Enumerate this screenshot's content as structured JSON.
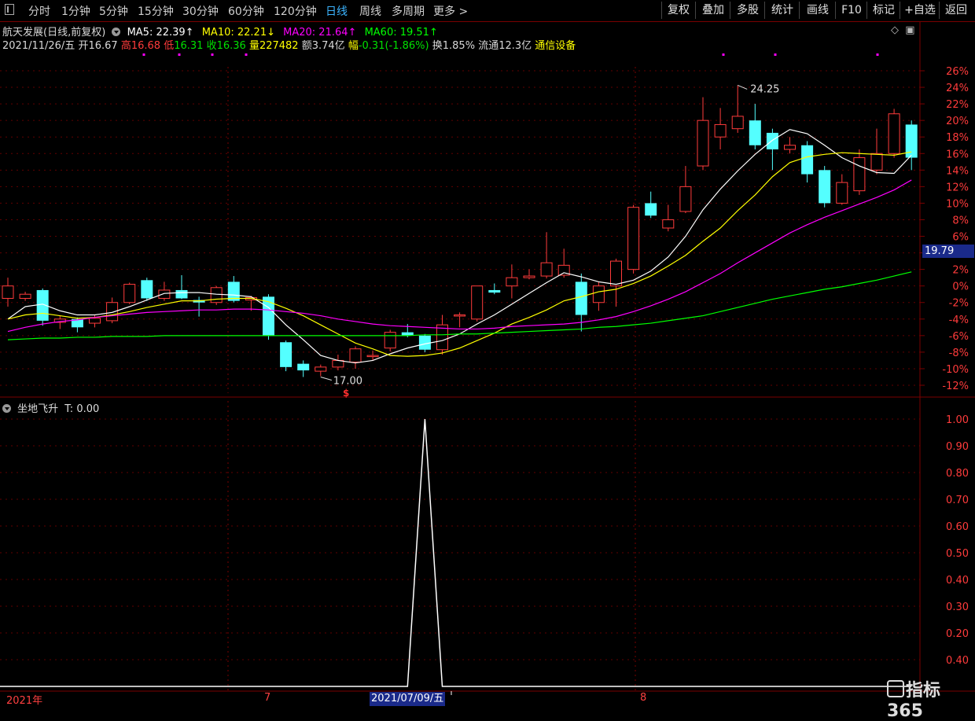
{
  "toolbar": {
    "left": [
      "分时",
      "1分钟",
      "5分钟",
      "15分钟",
      "30分钟",
      "60分钟",
      "120分钟",
      "日线",
      "周线",
      "多周期",
      "更多 >"
    ],
    "active": "日线",
    "right": [
      "复权",
      "叠加",
      "多股",
      "统计",
      "画线",
      "F10",
      "标记",
      "+自选",
      "返回"
    ]
  },
  "stock": {
    "name": "航天发展(日线,前复权)",
    "ma5": "MA5: 22.39↑",
    "ma10": "MA10: 22.21↓",
    "ma20": "MA20: 21.64↑",
    "ma60": "MA60: 19.51↑",
    "date": "2021/11/26/五",
    "open": "开16.67",
    "high_label": "高",
    "high": "16.68",
    "low_label": "低",
    "low": "16.31",
    "close_label": "收",
    "close": "16.36",
    "vol": "量227482",
    "amount": "额3.74亿",
    "change_label": "幅",
    "change": "-0.31(-1.86%)",
    "turnover": "换1.85%",
    "float": "流通12.3亿",
    "sector": "通信设备"
  },
  "price_tag": "19.79",
  "indicator": {
    "name": "坐地飞升",
    "t": "T: 0.00"
  },
  "dates": {
    "year": "2021年",
    "m7": "7",
    "highlight": "2021/07/09/五",
    "m8": "8"
  },
  "watermark": "指标365",
  "colors": {
    "up": "#ff3b3b",
    "down": "#54ffff",
    "ma5": "#ffffff",
    "ma10": "#ffff00",
    "ma20": "#ff00ff",
    "ma60": "#00ff00",
    "grid": "#7a0000"
  },
  "chart_data": [
    {
      "type": "candlestick",
      "y_axis_unit": "%",
      "ylim": [
        -13,
        27
      ],
      "yticks": [
        "26%",
        "24%",
        "22%",
        "20%",
        "18%",
        "16%",
        "14%",
        "12%",
        "10%",
        "8%",
        "6%",
        "4%",
        "2%",
        "0%",
        "-2%",
        "-4%",
        "-6%",
        "-8%",
        "-10%",
        "-12%"
      ],
      "annotations": [
        {
          "text": "24.25",
          "type": "high"
        },
        {
          "text": "17.00",
          "type": "low"
        }
      ],
      "candles": [
        {
          "o": -1.5,
          "c": 0.0,
          "h": 1.0,
          "l": -2.5
        },
        {
          "o": -1.5,
          "c": -1.0,
          "h": -0.7,
          "l": -1.8
        },
        {
          "o": -0.5,
          "c": -4.2,
          "h": -0.3,
          "l": -4.8
        },
        {
          "o": -4.4,
          "c": -4.0,
          "h": -3.6,
          "l": -5.2
        },
        {
          "o": -4.0,
          "c": -5.0,
          "h": -3.8,
          "l": -5.6
        },
        {
          "o": -4.5,
          "c": -3.9,
          "h": -3.5,
          "l": -5.0
        },
        {
          "o": -4.2,
          "c": -2.0,
          "h": -1.4,
          "l": -4.5
        },
        {
          "o": -2.0,
          "c": 0.2,
          "h": 0.4,
          "l": -2.2
        },
        {
          "o": 0.7,
          "c": -1.5,
          "h": 1.0,
          "l": -1.8
        },
        {
          "o": -1.5,
          "c": -0.5,
          "h": 0.5,
          "l": -1.8
        },
        {
          "o": -0.5,
          "c": -1.5,
          "h": 1.3,
          "l": -1.6
        },
        {
          "o": -1.7,
          "c": -2.0,
          "h": -1.3,
          "l": -3.7
        },
        {
          "o": -2.0,
          "c": -0.2,
          "h": 0.0,
          "l": -2.3
        },
        {
          "o": 0.5,
          "c": -1.8,
          "h": 1.2,
          "l": -2.0
        },
        {
          "o": -1.7,
          "c": -1.4,
          "h": -1.2,
          "l": -3.0
        },
        {
          "o": -1.3,
          "c": -6.0,
          "h": -1.0,
          "l": -6.5
        },
        {
          "o": -6.8,
          "c": -9.8,
          "h": -6.6,
          "l": -10.3
        },
        {
          "o": -9.4,
          "c": -10.2,
          "h": -9.0,
          "l": -11.0
        },
        {
          "o": -10.3,
          "c": -9.8,
          "h": -9.5,
          "l": -10.9
        },
        {
          "o": -9.8,
          "c": -9.0,
          "h": -8.3,
          "l": -10.2
        },
        {
          "o": -9.2,
          "c": -7.6,
          "h": -7.3,
          "l": -10.0
        },
        {
          "o": -8.5,
          "c": -8.4,
          "h": -7.8,
          "l": -9.0
        },
        {
          "o": -7.5,
          "c": -5.6,
          "h": -5.3,
          "l": -7.9
        },
        {
          "o": -5.6,
          "c": -6.0,
          "h": -4.6,
          "l": -6.2
        },
        {
          "o": -6.0,
          "c": -7.7,
          "h": -5.8,
          "l": -8.0
        },
        {
          "o": -7.7,
          "c": -4.7,
          "h": -3.5,
          "l": -8.3
        },
        {
          "o": -3.6,
          "c": -3.5,
          "h": -3.2,
          "l": -5.0
        },
        {
          "o": -4.0,
          "c": 0.0,
          "h": -0.5,
          "l": -4.3
        },
        {
          "o": -0.5,
          "c": -0.8,
          "h": 0.3,
          "l": -1.0
        },
        {
          "o": 0.0,
          "c": 1.0,
          "h": 2.6,
          "l": -1.5
        },
        {
          "o": 1.0,
          "c": 1.2,
          "h": 2.0,
          "l": 0.8
        },
        {
          "o": 1.2,
          "c": 2.8,
          "h": 6.5,
          "l": 0.9
        },
        {
          "o": 1.3,
          "c": 2.5,
          "h": 4.5,
          "l": 1.0
        },
        {
          "o": 0.5,
          "c": -3.5,
          "h": 1.5,
          "l": -5.5
        },
        {
          "o": -2.0,
          "c": 0.0,
          "h": 0.5,
          "l": -3.0
        },
        {
          "o": 0.0,
          "c": 3.0,
          "h": 3.3,
          "l": -2.5
        },
        {
          "o": 2.0,
          "c": 9.5,
          "h": 9.8,
          "l": 1.5
        },
        {
          "o": 10.0,
          "c": 8.5,
          "h": 11.4,
          "l": 8.2
        },
        {
          "o": 7.0,
          "c": 8.0,
          "h": 9.8,
          "l": 6.6
        },
        {
          "o": 9.0,
          "c": 12.0,
          "h": 14.5,
          "l": 8.8
        },
        {
          "o": 14.5,
          "c": 20.0,
          "h": 22.8,
          "l": 14.0
        },
        {
          "o": 18.0,
          "c": 19.5,
          "h": 21.5,
          "l": 16.5
        },
        {
          "o": 19.0,
          "c": 20.5,
          "h": 24.25,
          "l": 18.5
        },
        {
          "o": 20.0,
          "c": 17.0,
          "h": 22.0,
          "l": 16.5
        },
        {
          "o": 18.5,
          "c": 16.5,
          "h": 19.0,
          "l": 14.0
        },
        {
          "o": 16.5,
          "c": 17.0,
          "h": 18.0,
          "l": 16.0
        },
        {
          "o": 17.0,
          "c": 13.5,
          "h": 17.5,
          "l": 12.5
        },
        {
          "o": 14.0,
          "c": 10.0,
          "h": 14.5,
          "l": 9.5
        },
        {
          "o": 10.0,
          "c": 12.5,
          "h": 13.5,
          "l": 9.8
        },
        {
          "o": 11.5,
          "c": 15.5,
          "h": 16.5,
          "l": 11.0
        },
        {
          "o": 14.0,
          "c": 16.0,
          "h": 19.0,
          "l": 13.5
        },
        {
          "o": 16.0,
          "c": 20.8,
          "h": 21.4,
          "l": 15.5
        },
        {
          "o": 19.5,
          "c": 15.5,
          "h": 20.0,
          "l": 14.0
        }
      ],
      "series": [
        {
          "name": "MA5",
          "values": [
            -4.0,
            -2.5,
            -2.2,
            -3.0,
            -3.5,
            -3.5,
            -3.2,
            -2.5,
            -1.7,
            -0.9,
            -0.8,
            -0.8,
            -1.0,
            -1.1,
            -1.3,
            -2.6,
            -4.7,
            -6.5,
            -8.4,
            -9.0,
            -9.3,
            -9.0,
            -8.2,
            -7.5,
            -7.0,
            -6.6,
            -5.8,
            -4.6,
            -3.5,
            -2.2,
            -0.9,
            0.4,
            1.6,
            1.1,
            0.5,
            0.2,
            0.7,
            1.8,
            3.5,
            6.0,
            9.2,
            11.7,
            13.9,
            15.9,
            17.6,
            18.9,
            18.4,
            17.0,
            15.5,
            14.5,
            13.7,
            13.6,
            15.8
          ]
        },
        {
          "name": "MA10",
          "values": [
            -4.0,
            -3.5,
            -3.3,
            -3.6,
            -3.9,
            -3.8,
            -3.5,
            -3.1,
            -2.6,
            -2.2,
            -1.8,
            -1.8,
            -1.6,
            -1.5,
            -1.5,
            -1.9,
            -2.7,
            -3.6,
            -4.7,
            -5.8,
            -6.9,
            -7.6,
            -8.4,
            -8.5,
            -8.4,
            -8.1,
            -7.5,
            -6.6,
            -5.7,
            -4.6,
            -3.8,
            -2.9,
            -1.8,
            -1.3,
            -0.7,
            -0.4,
            0.3,
            1.2,
            2.4,
            3.7,
            5.4,
            7.0,
            9.1,
            11.0,
            13.2,
            14.9,
            15.6,
            15.9,
            16.1,
            16.0,
            15.9,
            15.8,
            16.2
          ]
        },
        {
          "name": "MA20",
          "values": [
            -5.5,
            -5.0,
            -4.6,
            -4.3,
            -4.1,
            -3.8,
            -3.6,
            -3.4,
            -3.2,
            -3.1,
            -3.0,
            -2.9,
            -2.9,
            -2.8,
            -2.8,
            -2.9,
            -3.1,
            -3.3,
            -3.6,
            -4.0,
            -4.3,
            -4.6,
            -4.8,
            -4.9,
            -5.0,
            -5.1,
            -5.2,
            -5.2,
            -5.1,
            -4.9,
            -4.8,
            -4.7,
            -4.6,
            -4.4,
            -4.1,
            -3.7,
            -3.1,
            -2.4,
            -1.6,
            -0.7,
            0.4,
            1.5,
            2.8,
            4.0,
            5.2,
            6.4,
            7.4,
            8.3,
            9.1,
            9.9,
            10.7,
            11.6,
            12.8
          ]
        },
        {
          "name": "MA60",
          "values": [
            -6.5,
            -6.4,
            -6.3,
            -6.3,
            -6.2,
            -6.2,
            -6.1,
            -6.1,
            -6.1,
            -6.0,
            -6.0,
            -6.0,
            -6.0,
            -6.0,
            -6.0,
            -6.0,
            -6.0,
            -6.0,
            -6.0,
            -6.0,
            -6.0,
            -6.0,
            -6.0,
            -6.0,
            -5.9,
            -5.9,
            -5.8,
            -5.8,
            -5.7,
            -5.6,
            -5.5,
            -5.4,
            -5.3,
            -5.2,
            -5.0,
            -4.9,
            -4.7,
            -4.5,
            -4.2,
            -3.9,
            -3.6,
            -3.1,
            -2.6,
            -2.1,
            -1.6,
            -1.2,
            -0.8,
            -0.4,
            -0.1,
            0.3,
            0.7,
            1.2,
            1.7
          ]
        }
      ]
    },
    {
      "type": "line",
      "name": "坐地飞升",
      "ylim": [
        0,
        1.05
      ],
      "yticks": [
        "1.00",
        "0.90",
        "0.80",
        "0.70",
        "0.60",
        "0.50",
        "0.40",
        "0.30",
        "0.20",
        "0.40"
      ],
      "values": [
        0,
        0,
        0,
        0,
        0,
        0,
        0,
        0,
        0,
        0,
        0,
        0,
        0,
        0,
        0,
        0,
        0,
        0,
        0,
        0,
        0,
        0,
        0,
        0,
        1,
        0,
        0,
        0,
        0,
        0,
        0,
        0,
        0,
        0,
        0,
        0,
        0,
        0,
        0,
        0,
        0,
        0,
        0,
        0,
        0,
        0,
        0,
        0,
        0,
        0,
        0,
        0,
        0
      ]
    }
  ]
}
